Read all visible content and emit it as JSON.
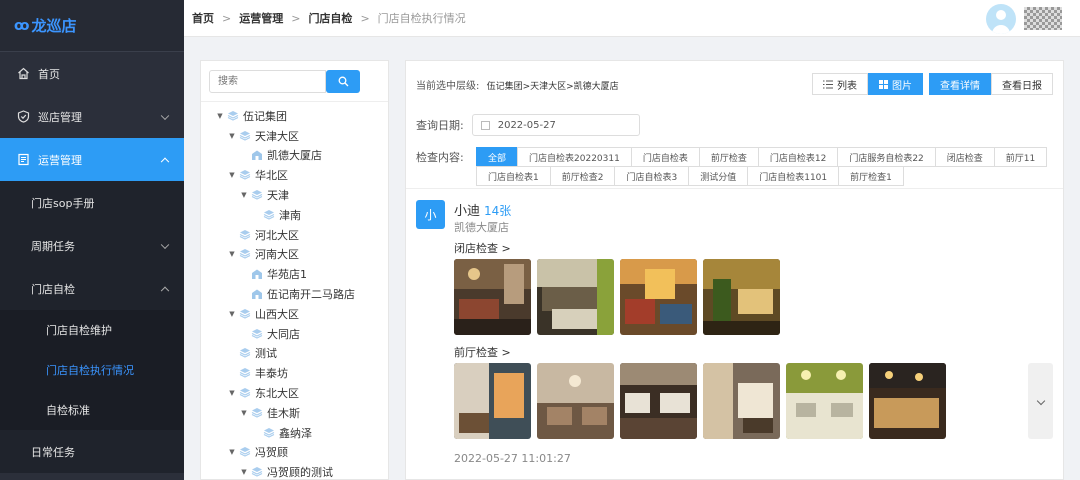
{
  "app": {
    "logo_text": "龙巡店",
    "logo_mark": "ꝏ"
  },
  "sidebar": {
    "items": [
      {
        "label": "首页",
        "icon": "home-icon"
      },
      {
        "label": "巡店管理",
        "icon": "shield-icon"
      },
      {
        "label": "运营管理",
        "icon": "document-icon"
      }
    ],
    "submenu": [
      {
        "label": "门店sop手册"
      },
      {
        "label": "周期任务"
      },
      {
        "label": "门店自检"
      }
    ],
    "subsub": [
      {
        "label": "门店自检维护"
      },
      {
        "label": "门店自检执行情况"
      },
      {
        "label": "自检标准"
      }
    ],
    "last_item": {
      "label": "日常任务"
    }
  },
  "breadcrumb": [
    "首页",
    "运营管理",
    "门店自检",
    "门店自检执行情况"
  ],
  "tree": {
    "search_placeholder": "搜索",
    "nodes": [
      {
        "label": "伍记集团",
        "depth": 0,
        "arrow": "▼",
        "type": "cube"
      },
      {
        "label": "天津大区",
        "depth": 1,
        "arrow": "▼",
        "type": "cube"
      },
      {
        "label": "凯德大厦店",
        "depth": 2,
        "arrow": "",
        "type": "store"
      },
      {
        "label": "华北区",
        "depth": 1,
        "arrow": "▼",
        "type": "cube"
      },
      {
        "label": "天津",
        "depth": 2,
        "arrow": "▼",
        "type": "cube"
      },
      {
        "label": "津南",
        "depth": 3,
        "arrow": "",
        "type": "cube"
      },
      {
        "label": "河北大区",
        "depth": 1,
        "arrow": "",
        "type": "cube"
      },
      {
        "label": "河南大区",
        "depth": 1,
        "arrow": "▼",
        "type": "cube"
      },
      {
        "label": "华苑店1",
        "depth": 2,
        "arrow": "",
        "type": "store"
      },
      {
        "label": "伍记南开二马路店",
        "depth": 2,
        "arrow": "",
        "type": "store"
      },
      {
        "label": "山西大区",
        "depth": 1,
        "arrow": "▼",
        "type": "cube"
      },
      {
        "label": "大同店",
        "depth": 2,
        "arrow": "",
        "type": "cube"
      },
      {
        "label": "测试",
        "depth": 1,
        "arrow": "",
        "type": "cube"
      },
      {
        "label": "丰泰坊",
        "depth": 1,
        "arrow": "",
        "type": "cube"
      },
      {
        "label": "东北大区",
        "depth": 1,
        "arrow": "▼",
        "type": "cube"
      },
      {
        "label": "佳木斯",
        "depth": 2,
        "arrow": "▼",
        "type": "cube"
      },
      {
        "label": "鑫纳泽",
        "depth": 3,
        "arrow": "",
        "type": "cube"
      },
      {
        "label": "冯贺顾",
        "depth": 1,
        "arrow": "▼",
        "type": "cube"
      },
      {
        "label": "冯贺顾的测试",
        "depth": 2,
        "arrow": "▼",
        "type": "cube"
      }
    ]
  },
  "content": {
    "path_label": "当前选中层级:",
    "path_value": "伍记集团>天津大区>凯德大厦店",
    "view_buttons": {
      "list": "列表",
      "image": "图片",
      "detail": "查看详情",
      "daily": "查看日报"
    },
    "date_label": "查询日期:",
    "date_value": "2022-05-27",
    "check_label": "检查内容:",
    "tags": [
      "全部",
      "门店自检表20220311",
      "门店自检表",
      "前厅检查",
      "门店自检表12",
      "门店服务自检表22",
      "闭店检查",
      "前厅11",
      "门店自检表1",
      "前厅检查2",
      "门店自检表3",
      "测试分值",
      "门店自检表1101",
      "前厅检查1"
    ],
    "record": {
      "avatar_letter": "小",
      "name": "小迪",
      "count": "14张",
      "store": "凯德大厦店",
      "section1": "闭店检查 >",
      "section2": "前厅检查 >",
      "time": "2022-05-27 11:01:27"
    }
  }
}
